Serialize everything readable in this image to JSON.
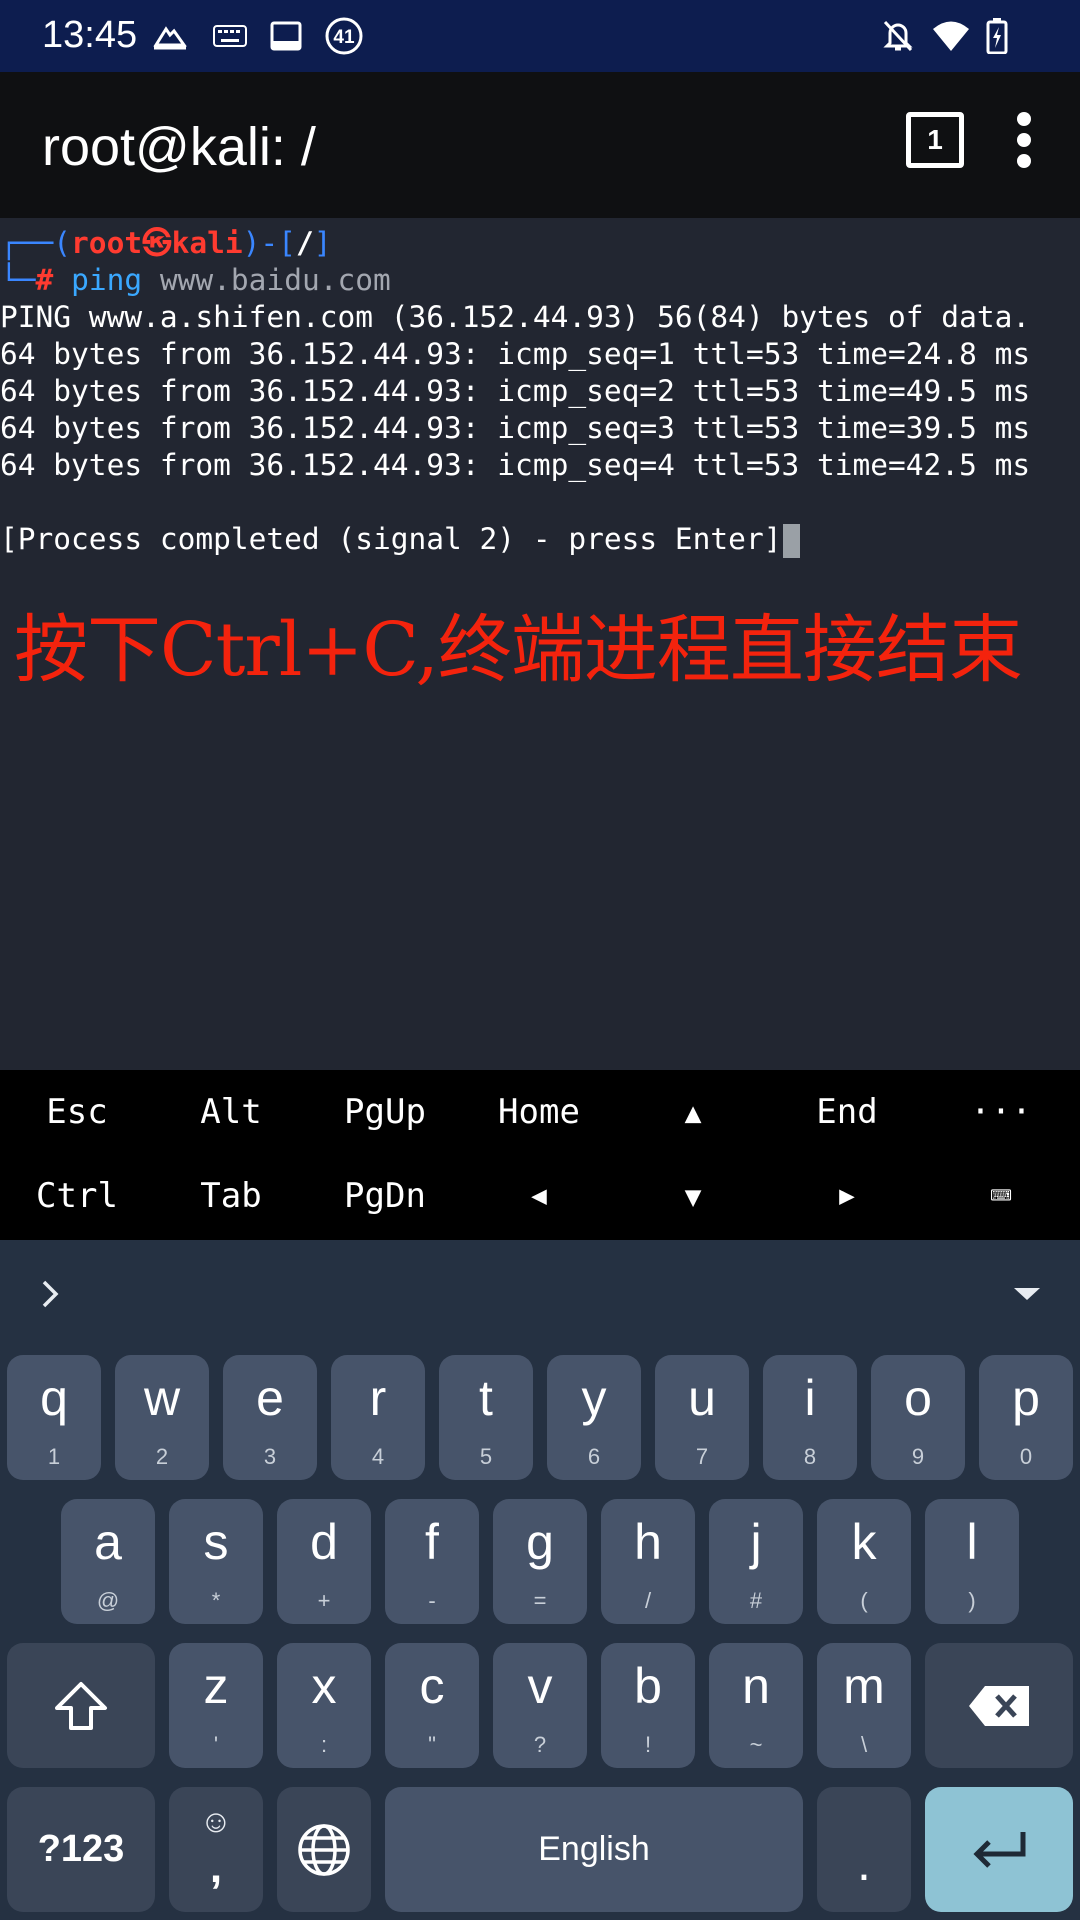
{
  "status_bar": {
    "time": "13:45",
    "notification_badge": "41",
    "icons": [
      "boat-icon",
      "keyboard-icon",
      "terminal-icon",
      "badge-icon",
      "mute-bell-icon",
      "wifi-icon",
      "battery-charging-icon"
    ]
  },
  "app_bar": {
    "title": "root@kali: /",
    "session_count": "1",
    "menu_icon": "more-vert-icon"
  },
  "terminal": {
    "prompt_open": "┌──(",
    "prompt_user": "root㉿kali",
    "prompt_mid": ")-[",
    "prompt_dir": "/",
    "prompt_close": "]",
    "prompt2_prefix": "└─",
    "prompt2_hash": "#",
    "command": "ping",
    "argument": "www.baidu.com",
    "output": [
      "PING www.a.shifen.com (36.152.44.93) 56(84) bytes of data.",
      "64 bytes from 36.152.44.93: icmp_seq=1 ttl=53 time=24.8 ms",
      "64 bytes from 36.152.44.93: icmp_seq=2 ttl=53 time=49.5 ms",
      "64 bytes from 36.152.44.93: icmp_seq=3 ttl=53 time=39.5 ms",
      "64 bytes from 36.152.44.93: icmp_seq=4 ttl=53 time=42.5 ms"
    ],
    "completion": "[Process completed (signal 2) - press Enter]",
    "annotation": "按下Ctrl+C,终端进程直接结束"
  },
  "extra_keys": {
    "row1": [
      "Esc",
      "Alt",
      "PgUp",
      "Home",
      "▲",
      "End",
      "···"
    ],
    "row2": [
      "Ctrl",
      "Tab",
      "PgDn",
      "◀",
      "▼",
      "▶",
      "⌨"
    ]
  },
  "keyboard": {
    "row1": [
      {
        "k": "q",
        "s": "1"
      },
      {
        "k": "w",
        "s": "2"
      },
      {
        "k": "e",
        "s": "3"
      },
      {
        "k": "r",
        "s": "4"
      },
      {
        "k": "t",
        "s": "5"
      },
      {
        "k": "y",
        "s": "6"
      },
      {
        "k": "u",
        "s": "7"
      },
      {
        "k": "i",
        "s": "8"
      },
      {
        "k": "o",
        "s": "9"
      },
      {
        "k": "p",
        "s": "0"
      }
    ],
    "row2": [
      {
        "k": "a",
        "s": "@"
      },
      {
        "k": "s",
        "s": "*"
      },
      {
        "k": "d",
        "s": "+"
      },
      {
        "k": "f",
        "s": "-"
      },
      {
        "k": "g",
        "s": "="
      },
      {
        "k": "h",
        "s": "/"
      },
      {
        "k": "j",
        "s": "#"
      },
      {
        "k": "k",
        "s": "("
      },
      {
        "k": "l",
        "s": ")"
      }
    ],
    "row3": [
      {
        "k": "z",
        "s": "'"
      },
      {
        "k": "x",
        "s": ":"
      },
      {
        "k": "c",
        "s": "\""
      },
      {
        "k": "v",
        "s": "?"
      },
      {
        "k": "b",
        "s": "!"
      },
      {
        "k": "n",
        "s": "~"
      },
      {
        "k": "m",
        "s": "\\"
      }
    ],
    "symbols_label": "?123",
    "comma_label": ",",
    "emoji_label": "☺",
    "space_label": "English",
    "period_label": "."
  }
}
